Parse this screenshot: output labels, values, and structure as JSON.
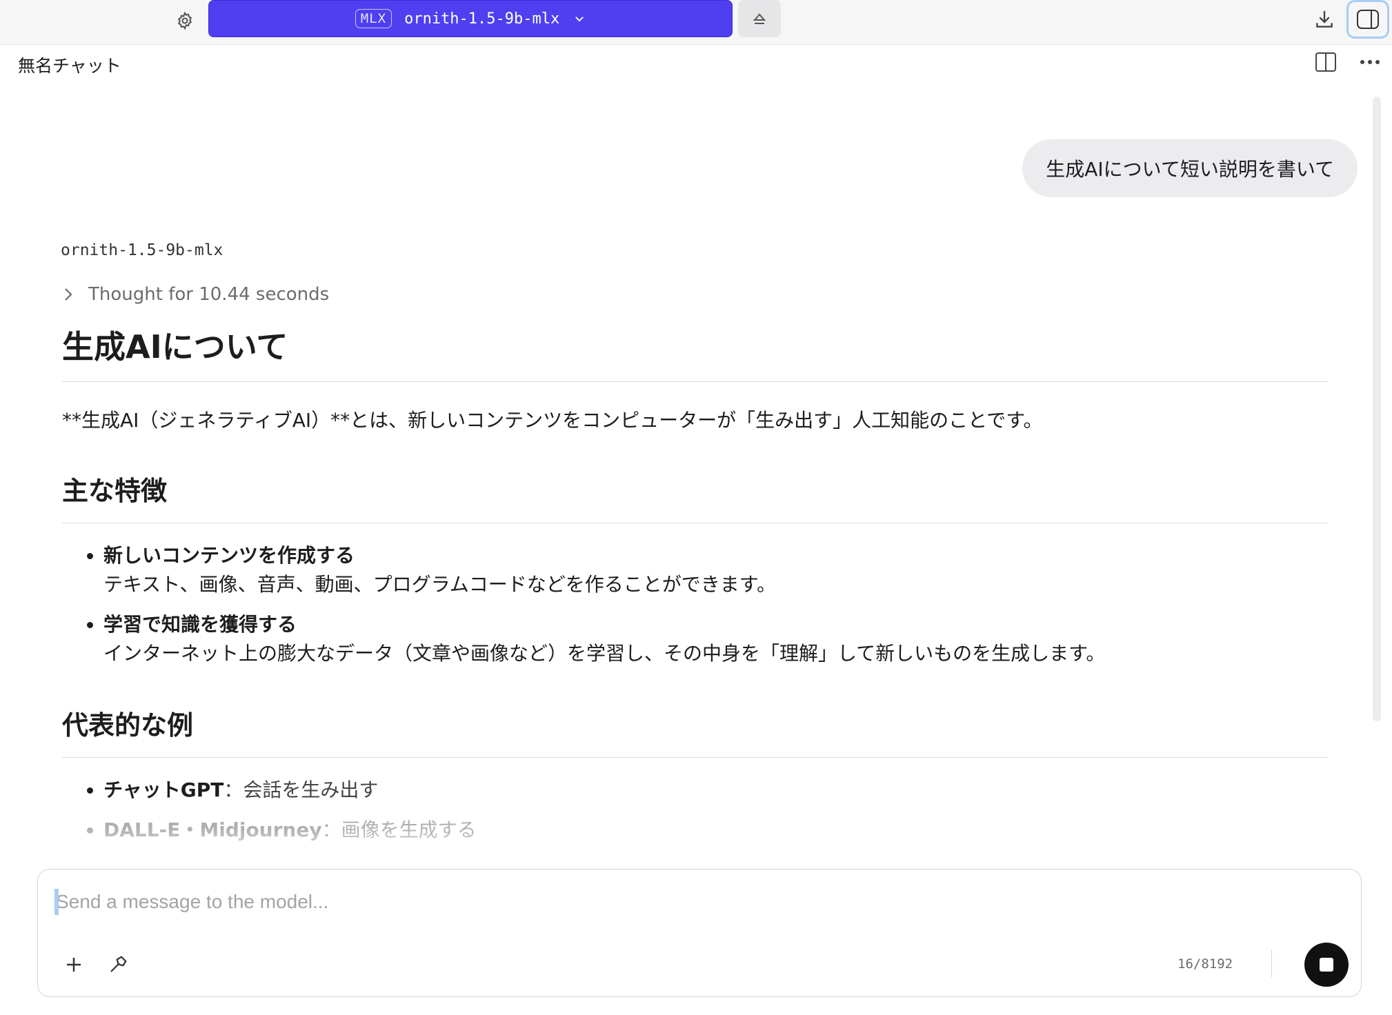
{
  "toolbar": {
    "model_badge": "MLX",
    "model_name": "ornith-1.5-9b-mlx"
  },
  "header": {
    "chat_title": "無名チャット"
  },
  "conversation": {
    "user_message": "生成AIについて短い説明を書いて",
    "assistant_model": "ornith-1.5-9b-mlx",
    "thought_label": "Thought for 10.44 seconds",
    "response": {
      "title": "生成AIについて",
      "intro": "**生成AI（ジェネラティブAI）**とは、新しいコンテンツをコンピューターが「生み出す」人工知能のことです。",
      "features_heading": "主な特徴",
      "features": [
        {
          "title": "新しいコンテンツを作成する",
          "desc": "テキスト、画像、音声、動画、プログラムコードなどを作ることができます。"
        },
        {
          "title": "学習で知識を獲得する",
          "desc": "インターネット上の膨大なデータ（文章や画像など）を学習し、その中身を「理解」して新しいものを生成します。"
        }
      ],
      "examples_heading": "代表的な例",
      "examples": [
        {
          "title": "チャットGPT",
          "desc": "：会話を生み出す"
        },
        {
          "title": "DALL-E・Midjourney",
          "desc": "：画像を生成する"
        }
      ]
    }
  },
  "composer": {
    "placeholder": "Send a message to the model...",
    "token_counter": "16/8192"
  },
  "colors": {
    "accent": "#4f3ff0",
    "focus": "#a9cdf3"
  }
}
